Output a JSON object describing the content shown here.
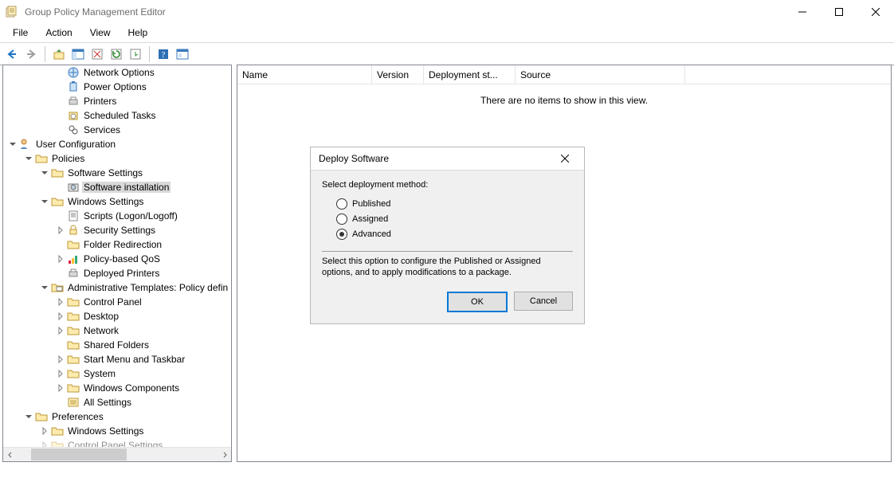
{
  "window": {
    "title": "Group Policy Management Editor"
  },
  "menu": {
    "file": "File",
    "action": "Action",
    "view": "View",
    "help": "Help"
  },
  "tree": {
    "i1": "Network Options",
    "i2": "Power Options",
    "i3": "Printers",
    "i4": "Scheduled Tasks",
    "i5": "Services",
    "user_cfg": "User Configuration",
    "policies": "Policies",
    "sw_settings": "Software Settings",
    "sw_install": "Software installation",
    "win_settings": "Windows Settings",
    "scripts": "Scripts (Logon/Logoff)",
    "sec": "Security Settings",
    "folder_redir": "Folder Redirection",
    "qos": "Policy-based QoS",
    "depl_printers": "Deployed Printers",
    "admin_tmpl": "Administrative Templates: Policy defin",
    "cpanel": "Control Panel",
    "desktop": "Desktop",
    "network": "Network",
    "shared": "Shared Folders",
    "startmenu": "Start Menu and Taskbar",
    "system": "System",
    "wincomp": "Windows Components",
    "allset": "All Settings",
    "prefs": "Preferences",
    "pref_win": "Windows Settings",
    "pref_cpl": "Control Panel Settings"
  },
  "right": {
    "cols": {
      "name": "Name",
      "version": "Version",
      "deploy_state": "Deployment st...",
      "source": "Source"
    },
    "empty": "There are no items to show in this view."
  },
  "dialog": {
    "title": "Deploy Software",
    "prompt": "Select deployment method:",
    "opt_published": "Published",
    "opt_assigned": "Assigned",
    "opt_advanced": "Advanced",
    "selected": "advanced",
    "description": "Select this option to configure the Published or Assigned options, and to apply modifications to a package.",
    "ok": "OK",
    "cancel": "Cancel"
  }
}
